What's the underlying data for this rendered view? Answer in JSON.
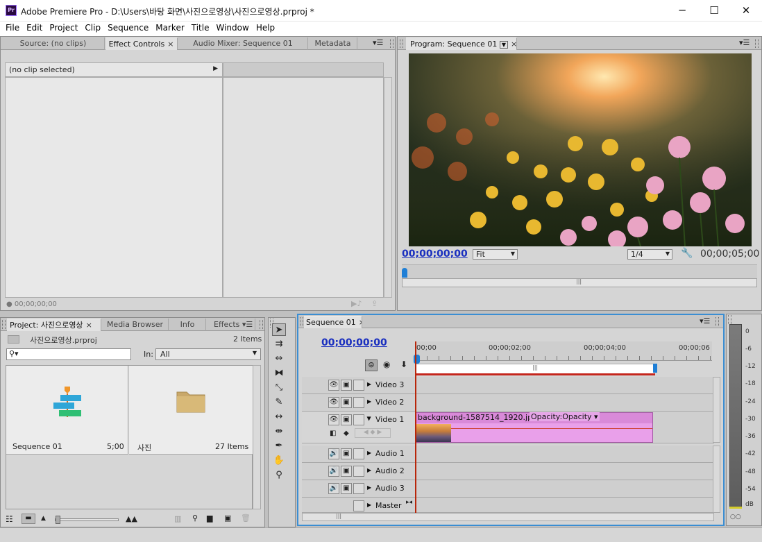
{
  "app": {
    "title": "Adobe Premiere Pro - D:\\Users\\바탕 화면\\사진으로영상\\사진으로영상.prproj *",
    "icon": "Pr"
  },
  "window_controls": {
    "minimize": "─",
    "maximize": "☐",
    "close": "✕"
  },
  "menu": [
    "File",
    "Edit",
    "Project",
    "Clip",
    "Sequence",
    "Marker",
    "Title",
    "Window",
    "Help"
  ],
  "source_panel": {
    "tabs": [
      "Source: (no clips)",
      "Effect Controls",
      "Audio Mixer: Sequence 01",
      "Metadata"
    ],
    "active_tab": "Effect Controls",
    "clip_label": "(no clip selected)",
    "timecode": "00;00;00;00"
  },
  "program_panel": {
    "tab": "Program: Sequence 01",
    "timecode_left": "00;00;00;00",
    "timecode_right": "00;00;05;00",
    "fit": "Fit",
    "resolution": "1/4"
  },
  "transport": {
    "mark_in": "{",
    "mark_out": "}",
    "goto_in": "{←",
    "step_back": "◀|",
    "play": "▶",
    "step_fwd": "|▶",
    "goto_out": "→}",
    "lift": "⊼",
    "extract": "⊻",
    "more": "»",
    "add": "+"
  },
  "project_panel": {
    "tabs": [
      "Project: 사진으로영상",
      "Media Browser",
      "Info",
      "Effects"
    ],
    "project_file": "사진으로영상.prproj",
    "items_count": "2 Items",
    "search_placeholder": "",
    "in_label": "In:",
    "in_value": "All",
    "items": [
      {
        "name": "Sequence 01",
        "meta": "5;00",
        "icon": "sequence-icon"
      },
      {
        "name": "사진",
        "meta": "27 Items",
        "icon": "folder-icon"
      }
    ]
  },
  "timeline": {
    "tab": "Sequence 01",
    "timecode": "00;00;00;00",
    "ruler": [
      "00;00",
      "00;00;02;00",
      "00;00;04;00",
      "00;00;06"
    ],
    "video_tracks": [
      "Video 3",
      "Video 2",
      "Video 1"
    ],
    "audio_tracks": [
      "Audio 1",
      "Audio 2",
      "Audio 3"
    ],
    "master": "Master",
    "clip": {
      "name": "background-1587514_1920.jpg",
      "effect": "Opacity:Opacity ▾",
      "duration_fraction": 0.69
    }
  },
  "meter": {
    "ticks": [
      "0",
      "-6",
      "-12",
      "-18",
      "-24",
      "-30",
      "-36",
      "-42",
      "-48",
      "-54",
      "dB"
    ]
  },
  "colors": {
    "timecode": "#1a2fbf",
    "clip": "#e9a0ea",
    "playhead": "#b8260a"
  }
}
